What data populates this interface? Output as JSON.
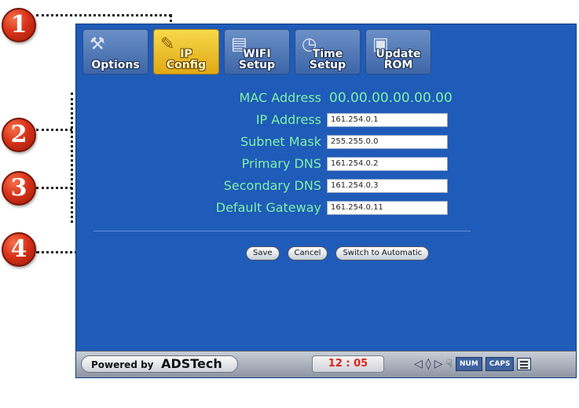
{
  "callouts": [
    "1",
    "2",
    "3",
    "4"
  ],
  "toolbar": [
    {
      "label_top": "",
      "label": "Options",
      "icon": "wrench-icon",
      "active": false
    },
    {
      "label_top": "IP",
      "label": "Config",
      "icon": "pencil-icon",
      "active": true
    },
    {
      "label_top": "WIFI",
      "label": "Setup",
      "icon": "router-icon",
      "active": false
    },
    {
      "label_top": "Time",
      "label": "Setup",
      "icon": "clock-icon",
      "active": false
    },
    {
      "label_top": "Update",
      "label": "ROM",
      "icon": "chip-icon",
      "active": false
    }
  ],
  "form": {
    "mac": {
      "label": "MAC Address",
      "value": "00.00.00.00.00.00"
    },
    "fields": [
      {
        "label": "IP Address",
        "value": "161.254.0.1"
      },
      {
        "label": "Subnet Mask",
        "value": "255.255.0.0"
      },
      {
        "label": "Primary DNS",
        "value": "161.254.0.2"
      },
      {
        "label": "Secondary DNS",
        "value": "161.254.0.3"
      },
      {
        "label": "Default Gateway",
        "value": "161.254.0.11"
      }
    ]
  },
  "buttons": {
    "save": "Save",
    "cancel": "Cancel",
    "switch": "Switch to Automatic"
  },
  "statusbar": {
    "powered_by": "Powered by",
    "brand": "ADSTech",
    "clock": "12 : 05",
    "num": "NUM",
    "caps": "CAPS"
  },
  "colors": {
    "screen_bg": "#1f5bb8",
    "label_green": "#7ff0a8",
    "clock_red": "#e0241a",
    "active_tab": "#f0c22a"
  }
}
